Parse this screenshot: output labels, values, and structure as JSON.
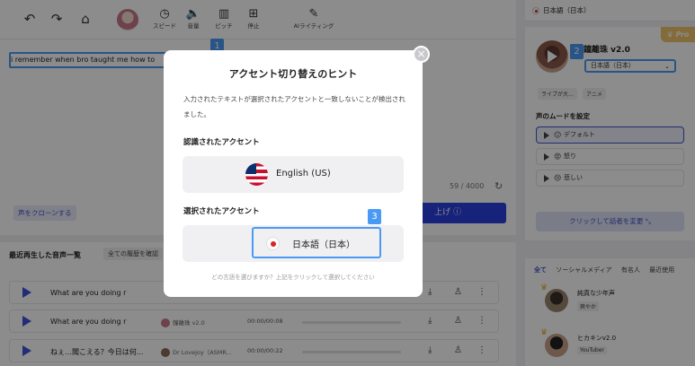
{
  "toolbar": {
    "tools": [
      {
        "label": "スピード"
      },
      {
        "label": "音量"
      },
      {
        "label": "ピッチ"
      },
      {
        "label": "停止"
      },
      {
        "label": "AIライティング"
      }
    ]
  },
  "editor": {
    "text": "i remember when bro taught me how to",
    "counter": "59 / 4000",
    "clone_button": "声をクローンする",
    "generate_button": "上げ"
  },
  "recent": {
    "title": "最近再生した音声一覧",
    "history_chip": "全ての履歴を確認",
    "rows": [
      {
        "text": "What are you doing r",
        "voice": "",
        "time": ""
      },
      {
        "text": "What are you doing r",
        "voice": "鐘離珠 v2.0",
        "time": "00:00/00:08"
      },
      {
        "text": "ねぇ…聞こえる？今日は何...",
        "voice": "Dr Lovejoy（ASMR...",
        "time": "00:00/00:22"
      }
    ]
  },
  "right_panel": {
    "top_language": "日本語（日本）",
    "pro_badge": "Pro",
    "voice_name": "鐘離珠 v2.0",
    "voice_language": "日本語（日本）",
    "tags": [
      "ライブが大...",
      "アニメ"
    ],
    "mood_title": "声のムードを設定",
    "moods": [
      {
        "label": "デフォルト",
        "emoji": "😐"
      },
      {
        "label": "怒り",
        "emoji": "😡"
      },
      {
        "label": "悲しい",
        "emoji": "😢"
      }
    ],
    "change_button": "クリックして話者を変更",
    "voice_tabs": [
      "全て",
      "ソーシャルメディア",
      "有名人",
      "最近使用"
    ],
    "voices": [
      {
        "name": "純真な少年声",
        "tag": "爽やか"
      },
      {
        "name": "ヒカキンv2.0",
        "tag": "YouTuber"
      }
    ]
  },
  "markers": {
    "m1": "1",
    "m2": "2",
    "m3": "3"
  },
  "dialog": {
    "title": "アクセント切り替えのヒント",
    "description": "入力されたテキストが選択されたアクセントと一致しないことが検出されました。",
    "recognized_heading": "認識されたアクセント",
    "recognized_accent": "English (US)",
    "selected_heading": "選択されたアクセント",
    "selected_accent": "日本語（日本）",
    "footer": "どの言語を選びますか？上記をクリックして選択してください",
    "close_symbol": "×"
  }
}
